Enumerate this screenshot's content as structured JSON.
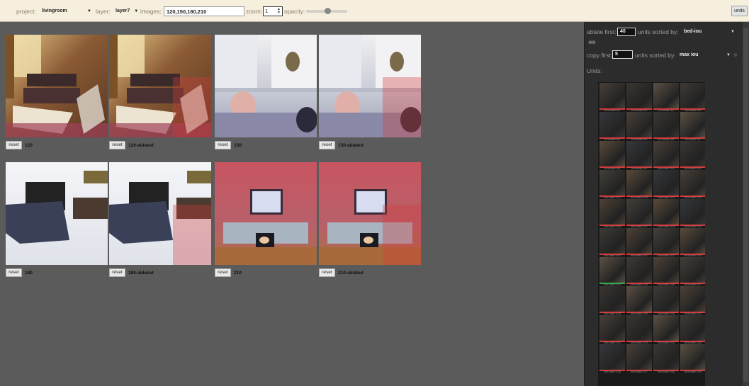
{
  "toolbar": {
    "project_label": "project:",
    "project_value": "livingroom",
    "layer_label": "layer:",
    "layer_value": "layer7",
    "images_label": "images:",
    "images_value": "120,150,180,210",
    "zoom_label": "zoom:",
    "zoom_value": "1",
    "opacity_label": "opacity:",
    "opacity_level": 0.5,
    "units_button": "units"
  },
  "tiles": [
    {
      "label": "120",
      "reset": "reset"
    },
    {
      "label": "120-ablated",
      "reset": "reset"
    },
    {
      "label": "150",
      "reset": "reset"
    },
    {
      "label": "150-ablated",
      "reset": "reset"
    },
    {
      "label": "180",
      "reset": "reset"
    },
    {
      "label": "180-ablated",
      "reset": "reset"
    },
    {
      "label": "210",
      "reset": "reset"
    },
    {
      "label": "210-ablated",
      "reset": "reset"
    }
  ],
  "panel": {
    "ablate_label": "ablate first:",
    "ablate_value": "40",
    "ablate_sort_label": "units sorted by:",
    "ablate_sort_value": "bed-iou",
    "copy_label": "copy first:",
    "copy_value": "5",
    "copy_sort_label": "units sorted by:",
    "copy_sort_value": "max iou",
    "units_heading": "Units:",
    "units": [
      "mountain #2",
      "mountain #3",
      "mountain #2",
      "mountain #5",
      "mountain #4",
      "mountain #5",
      "mountain #6",
      "mountain #7",
      "mountain #8",
      "mountain #9",
      "mountain #10",
      "mountain #11",
      "mountain #12",
      "mountain #13",
      "mountain #14",
      "mountain #15",
      "mountain #16",
      "mountain #17",
      "mountain #18",
      "mountain #19",
      "mountain #20",
      "mountain #21",
      "mountain #22",
      "mountain #23",
      "mountain #24",
      "mountain #25",
      "mountain #26",
      "mountain #27",
      "mountain #28",
      "mountain #29",
      "mountain #30",
      "mountain #31",
      "mountain #32",
      "mountain #33",
      "mountain #34",
      "mountain #35",
      "mountain #36",
      "mountain #37",
      "mountain #38",
      "mountain #39"
    ]
  },
  "colors": {
    "toolbar_bg": "#f7efdd",
    "canvas_bg": "#5b5b5b",
    "panel_bg": "#2c2c2c",
    "ablated_marker": "#d23b3b",
    "copied_marker": "#2fa84a"
  }
}
